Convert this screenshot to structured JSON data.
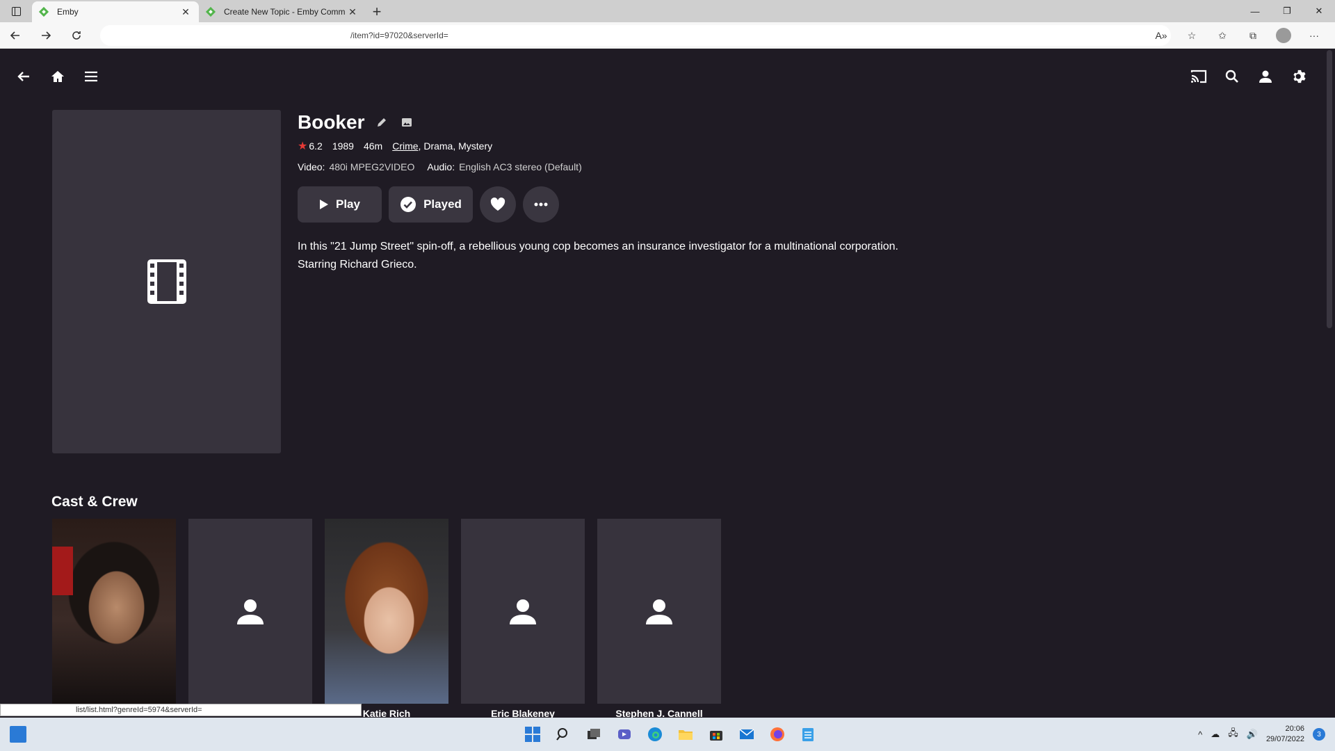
{
  "browser": {
    "tabs": [
      {
        "title": "Emby",
        "active": true
      },
      {
        "title": "Create New Topic - Emby Comm",
        "active": false
      }
    ],
    "url": "/item?id=97020&serverId=",
    "status_url": "list/list.html?genreId=5974&serverId="
  },
  "item": {
    "title": "Booker",
    "rating": "6.2",
    "year": "1989",
    "runtime": "46m",
    "genres": [
      "Crime",
      "Drama",
      "Mystery"
    ],
    "video_label": "Video:",
    "video_value": "480i MPEG2VIDEO",
    "audio_label": "Audio:",
    "audio_value": "English AC3 stereo (Default)",
    "overview": "In this \"21 Jump Street\" spin-off, a rebellious young cop becomes an insurance investigator for a multinational corporation. Starring Richard Grieco."
  },
  "actions": {
    "play_label": "Play",
    "played_label": "Played"
  },
  "cast_section": {
    "title": "Cast & Crew",
    "people": [
      {
        "name": "",
        "photo": "face-man"
      },
      {
        "name": "",
        "photo": "person-placeholder-icon"
      },
      {
        "name": "Katie Rich",
        "photo": "face-woman"
      },
      {
        "name": "Eric Blakeney",
        "photo": "person-placeholder-icon"
      },
      {
        "name": "Stephen J. Cannell",
        "photo": "person-placeholder-icon"
      }
    ]
  },
  "taskbar": {
    "time": "20:06",
    "date": "29/07/2022",
    "notifications": "3"
  },
  "colors": {
    "background": "#1f1b24",
    "card": "#37333d",
    "button": "#3a3640",
    "star": "#e53935",
    "emby_green": "#52b54b"
  }
}
